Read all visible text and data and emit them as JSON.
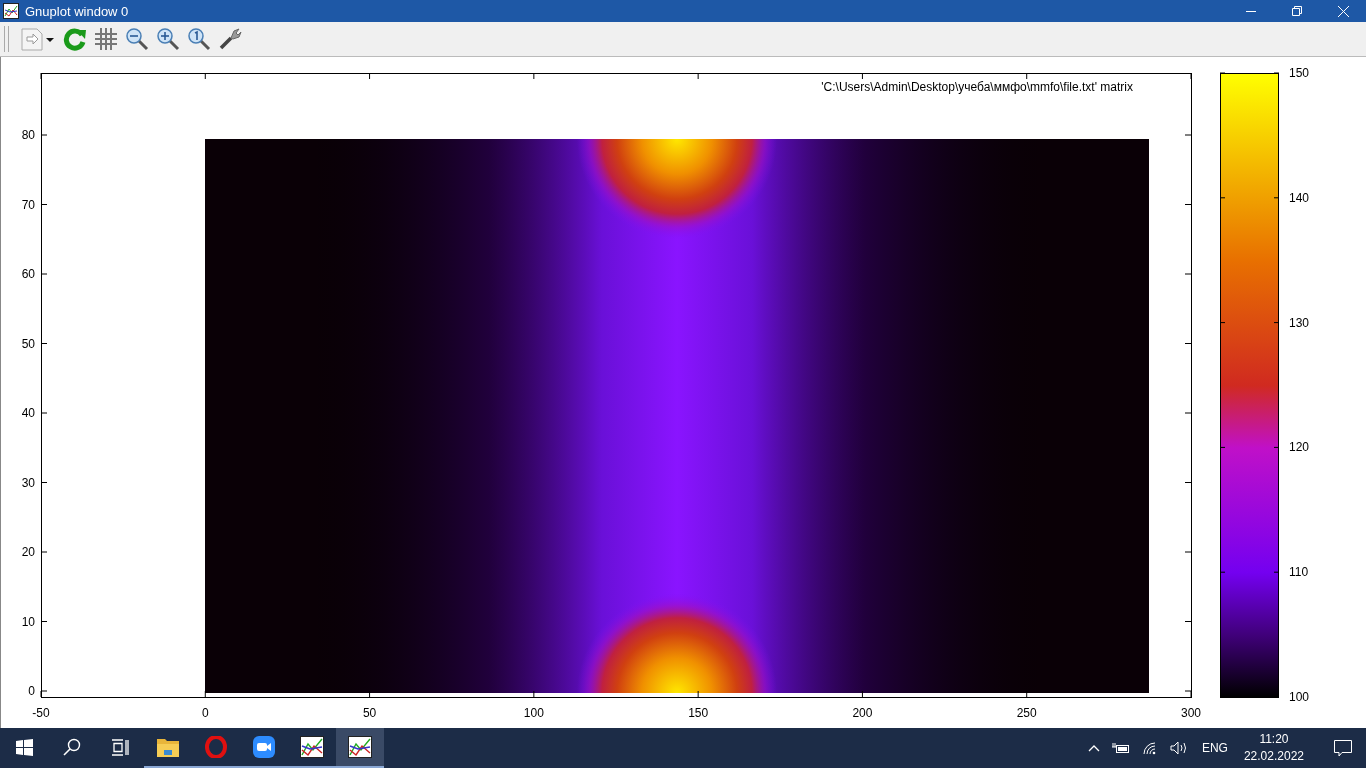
{
  "window": {
    "title": "Gnuplot window 0"
  },
  "toolbar": [
    {
      "kind": "export"
    },
    {
      "kind": "replot"
    },
    {
      "kind": "grid"
    },
    {
      "kind": "zoom-out"
    },
    {
      "kind": "zoom-in"
    },
    {
      "kind": "zoom-reset"
    },
    {
      "kind": "options"
    }
  ],
  "plot": {
    "legend": "'C:\\Users\\Admin\\Desktop\\учеба\\ммфо\\mmfo\\file.txt' matrix",
    "x_tick_labels": [
      "-50",
      "0",
      "50",
      "100",
      "150",
      "200",
      "250",
      "300"
    ],
    "y_tick_labels": [
      "80",
      "70",
      "60",
      "50",
      "40",
      "30",
      "20",
      "10",
      "0"
    ],
    "colorbar_labels": [
      "150",
      "140",
      "130",
      "120",
      "110",
      "100"
    ]
  },
  "taskbar": {
    "apps": [
      {
        "kind": "explorer",
        "running": true,
        "selected": false
      },
      {
        "kind": "opera",
        "running": true,
        "selected": false
      },
      {
        "kind": "zoom",
        "running": true,
        "selected": false
      },
      {
        "kind": "gnuplot",
        "running": true,
        "selected": false
      },
      {
        "kind": "gnuplot",
        "running": true,
        "selected": true
      }
    ],
    "language": "ENG",
    "time": "11:20",
    "date": "22.02.2022"
  }
}
